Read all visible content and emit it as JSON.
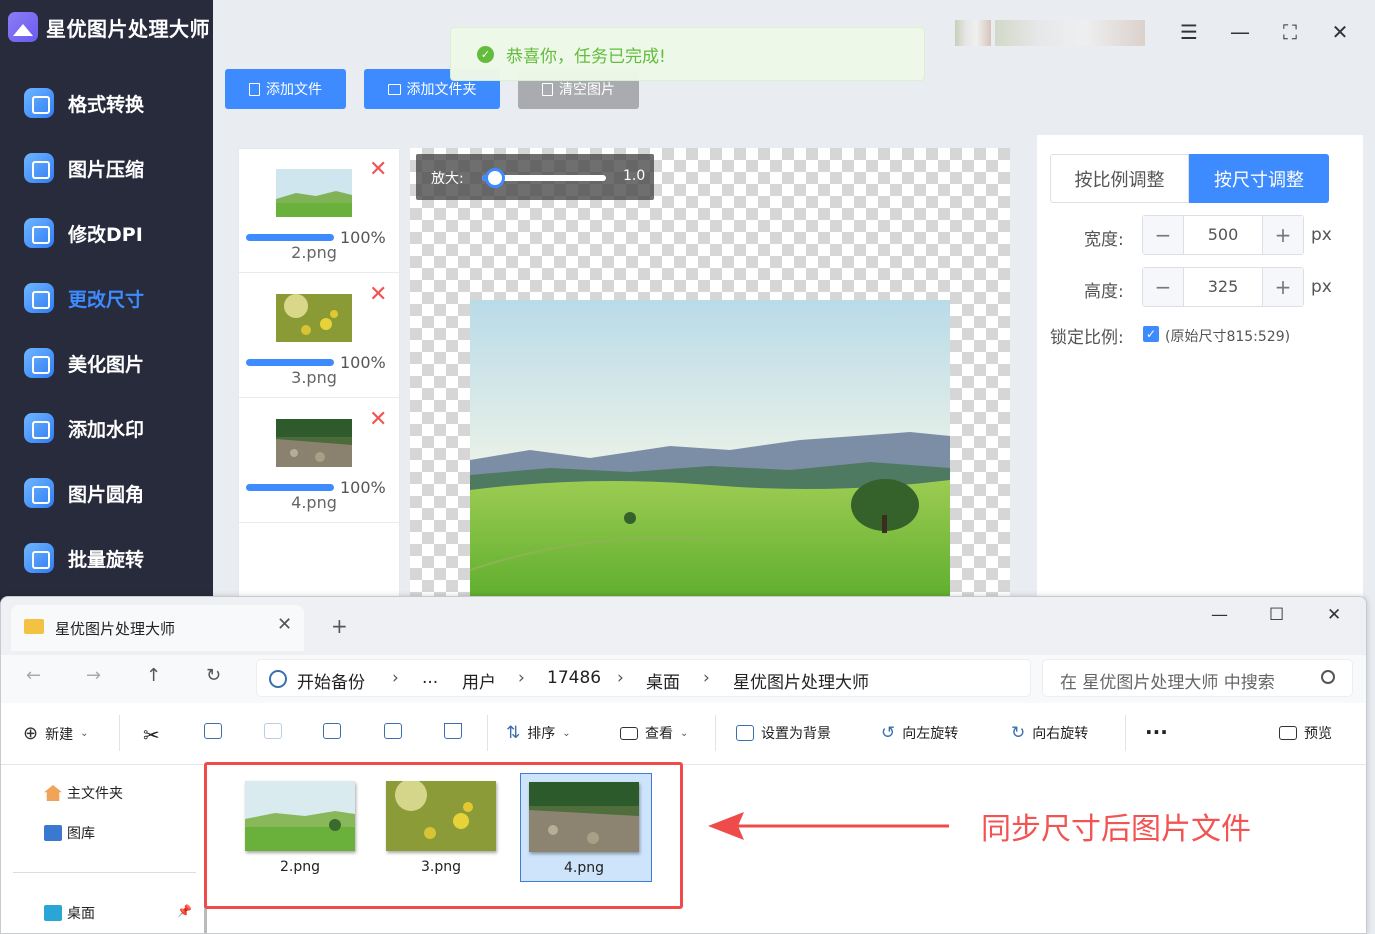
{
  "app": {
    "title": "星优图片处理大师"
  },
  "sidebar": {
    "items": [
      {
        "label": "格式转换",
        "icon": "image-convert-icon"
      },
      {
        "label": "图片压缩",
        "icon": "compress-icon"
      },
      {
        "label": "修改DPI",
        "icon": "dpi-icon"
      },
      {
        "label": "更改尺寸",
        "icon": "resize-icon",
        "active": true
      },
      {
        "label": "美化图片",
        "icon": "beautify-icon"
      },
      {
        "label": "添加水印",
        "icon": "watermark-icon"
      },
      {
        "label": "图片圆角",
        "icon": "round-corner-icon"
      },
      {
        "label": "批量旋转",
        "icon": "rotate-icon"
      }
    ]
  },
  "toolbar": {
    "add_file": "添加文件",
    "add_folder": "添加文件夹",
    "clear": "清空图片"
  },
  "toast": {
    "message": "恭喜你，任务已完成!"
  },
  "files": [
    {
      "name": "2.png",
      "progress": "100%"
    },
    {
      "name": "3.png",
      "progress": "100%"
    },
    {
      "name": "4.png",
      "progress": "100%"
    }
  ],
  "zoom": {
    "label": "放大:",
    "value": "1.0"
  },
  "settings": {
    "mode_ratio": "按比例调整",
    "mode_size": "按尺寸调整",
    "width_label": "宽度:",
    "width_value": "500",
    "height_label": "高度:",
    "height_value": "325",
    "unit": "px",
    "lock_label": "锁定比例:",
    "lock_note": "(原始尺寸815:529)"
  },
  "explorer": {
    "tab_title": "星优图片处理大师",
    "breadcrumb": [
      "开始备份",
      "...",
      "用户",
      "17486",
      "桌面",
      "星优图片处理大师"
    ],
    "search_placeholder": "在 星优图片处理大师 中搜索",
    "commands": {
      "new": "新建",
      "sort": "排序",
      "view": "查看",
      "set_bg": "设置为背景",
      "rotate_left": "向左旋转",
      "rotate_right": "向右旋转",
      "more": "...",
      "preview": "预览"
    },
    "sidebar": [
      "主文件夹",
      "图库",
      "桌面"
    ],
    "files": [
      "2.png",
      "3.png",
      "4.png"
    ]
  },
  "annotation": {
    "text": "同步尺寸后图片文件"
  },
  "colors": {
    "accent": "#3d8bff",
    "sidebar": "#272b3b",
    "success": "#5fbb37",
    "annotation": "#ef4b4b"
  }
}
